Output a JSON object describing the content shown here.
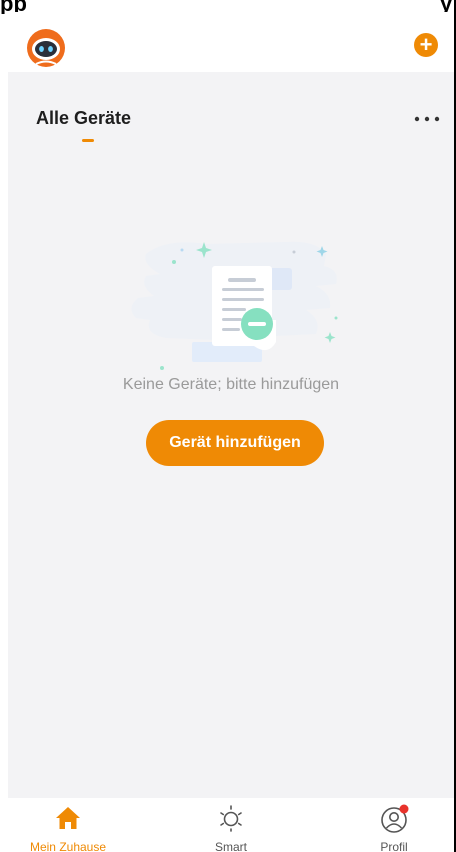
{
  "caption": {
    "left_fragment": "pp",
    "right_fragment": "y"
  },
  "header": {
    "avatar_icon": "robot-avatar-icon",
    "add_icon_glyph": "+"
  },
  "section": {
    "title": "Alle Geräte",
    "more_icon": "more-dots-icon"
  },
  "empty_state": {
    "illustration": "empty-list-illustration",
    "message": "Keine Geräte; bitte hinzufügen",
    "button_label": "Gerät hinzufügen"
  },
  "bottom_nav": {
    "items": [
      {
        "label": "Mein Zuhause",
        "icon": "home-icon",
        "active": true
      },
      {
        "label": "Smart",
        "icon": "sun-icon",
        "active": false
      },
      {
        "label": "Profil",
        "icon": "profile-icon",
        "active": false,
        "badge": true
      }
    ]
  },
  "colors": {
    "accent": "#ef8a05",
    "background": "#f3f3f5",
    "badge": "#e8322b"
  }
}
